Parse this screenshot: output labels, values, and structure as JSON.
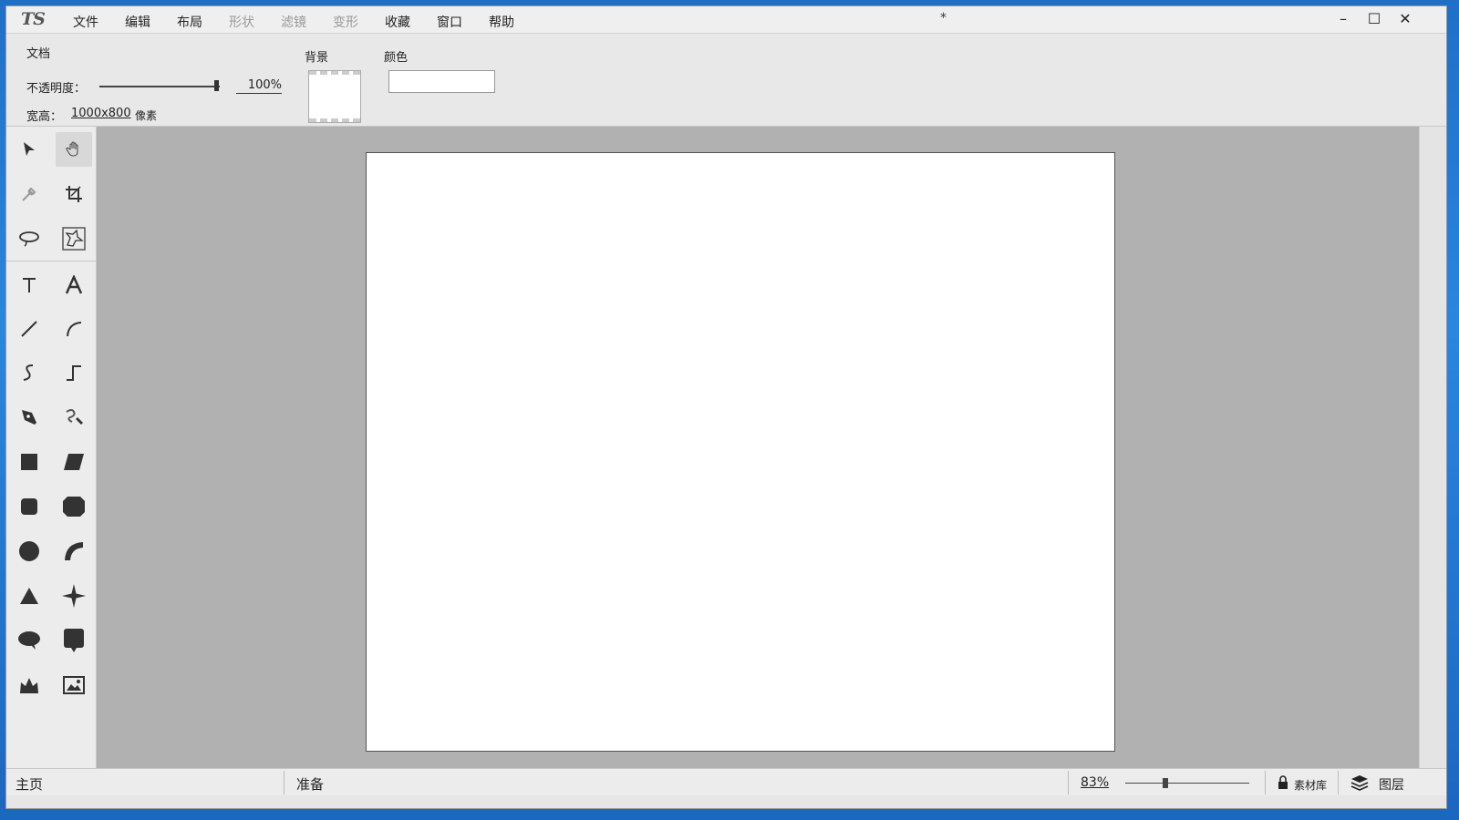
{
  "app": {
    "logo": "TS",
    "document_title": "*"
  },
  "menu": {
    "items": [
      {
        "label": "文件",
        "disabled": false
      },
      {
        "label": "编辑",
        "disabled": false
      },
      {
        "label": "布局",
        "disabled": false
      },
      {
        "label": "形状",
        "disabled": true
      },
      {
        "label": "滤镜",
        "disabled": true
      },
      {
        "label": "变形",
        "disabled": true
      },
      {
        "label": "收藏",
        "disabled": false
      },
      {
        "label": "窗口",
        "disabled": false
      },
      {
        "label": "帮助",
        "disabled": false
      }
    ]
  },
  "window_controls": {
    "minimize": "–",
    "maximize": "☐",
    "close": "✕"
  },
  "properties": {
    "section_title": "文档",
    "opacity_label": "不透明度：",
    "opacity_value": "100%",
    "opacity_fraction": 1.0,
    "size_label": "宽高：",
    "size_value": "1000x800",
    "size_unit": "像素",
    "background_label": "背景",
    "color_label": "颜色"
  },
  "tools": [
    "select-arrow-icon",
    "hand-icon",
    "eyedropper-icon",
    "crop-icon",
    "lasso-icon",
    "magic-lasso-icon",
    "text-icon",
    "art-text-icon",
    "line-icon",
    "arc-icon",
    "curve-icon",
    "polyline-icon",
    "pen-icon",
    "freehand-pen-icon",
    "rectangle-icon",
    "parallelogram-icon",
    "rounded-rect-icon",
    "octagon-icon",
    "circle-icon",
    "arc-shape-icon",
    "triangle-icon",
    "star-icon",
    "speech-bubble-icon",
    "callout-icon",
    "crown-icon",
    "image-icon"
  ],
  "status": {
    "home": "主页",
    "state": "准备",
    "zoom": "83%",
    "zoom_fraction": 0.3,
    "library": "素材库",
    "layers": "图层"
  }
}
